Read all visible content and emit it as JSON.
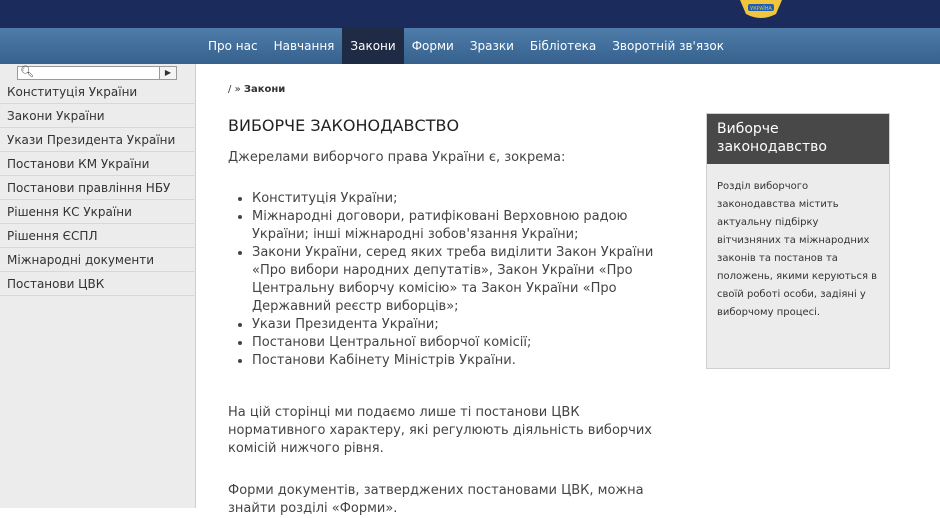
{
  "header": {
    "logo_text": "УКРАЇНА"
  },
  "nav": {
    "items": [
      "Про нас",
      "Навчання",
      "Закони",
      "Форми",
      "Зразки",
      "Бібліотека",
      "Зворотній зв'язок"
    ],
    "active_index": 2
  },
  "sidebar": {
    "search_icon": "search-icon",
    "items": [
      "Конституція України",
      "Закони України",
      "Укази Президента України",
      "Постанови КМ України",
      "Постанови правління НБУ",
      "Рішення КС України",
      "Рішення ЄСПЛ",
      "Міжнародні документи",
      "Постанови ЦВК"
    ]
  },
  "breadcrumb": {
    "root": "/",
    "separator": "»",
    "current": "Закони"
  },
  "content": {
    "title": "ВИБОРЧЕ ЗАКОНОДАВСТВО",
    "intro": "Джерелами виборчого права України є, зокрема:",
    "bullets": [
      "Конституція України;",
      "Міжнародні договори, ратифіковані Верховною радою України; інші міжнародні зобов'язання України;",
      "Закони України, серед яких треба виділити  Закон України «Про вибори народних депутатів», Закон України «Про Центральну виборчу комісію» та Закон України «Про Державний реєстр виборців»;",
      "Укази Президента України;",
      "Постанови Центральної виборчої комісії;",
      "Постанови Кабінету Міністрів України."
    ],
    "paragraph1": "На цій сторінці ми подаємо лише ті постанови ЦВК нормативного характеру, які регулюють діяльність виборчих комісій нижчого рівня.",
    "paragraph2": "Форми документів, затверджених постановами ЦВК, можна знайти розділі «Форми»."
  },
  "infobox": {
    "title": "Виборче законодавство",
    "text": "Розділ виборчого законодавства містить актуальну підбірку вітчизняних та міжнародних законів та постанов та положень, якими керуються в своїй роботі особи, задіяні у виборчому процесі."
  },
  "colors": {
    "topbar": "#1a2b5c",
    "nav": "#36618e",
    "nav_active": "#1f2a44",
    "infobox_header": "#484848"
  }
}
